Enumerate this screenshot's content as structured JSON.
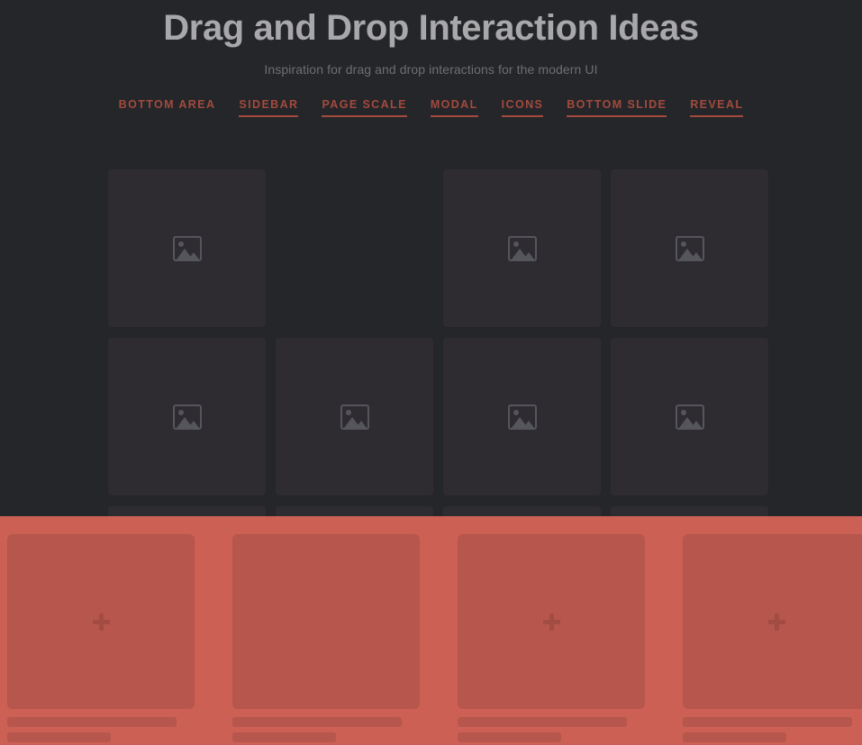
{
  "header": {
    "title": "Drag and Drop Interaction Ideas",
    "subtitle": "Inspiration for drag and drop interactions for the modern UI"
  },
  "nav": {
    "items": [
      {
        "label": "BOTTOM AREA",
        "active": true
      },
      {
        "label": "SIDEBAR",
        "active": false
      },
      {
        "label": "PAGE SCALE",
        "active": false
      },
      {
        "label": "MODAL",
        "active": false
      },
      {
        "label": "ICONS",
        "active": false
      },
      {
        "label": "BOTTOM SLIDE",
        "active": false
      },
      {
        "label": "REVEAL",
        "active": false
      }
    ]
  },
  "gallery": {
    "icon_name": "image-placeholder-icon",
    "rows": [
      {
        "tiles": [
          {
            "filled": true
          },
          {
            "filled": false
          },
          {
            "filled": true
          },
          {
            "filled": true
          }
        ]
      },
      {
        "tiles": [
          {
            "filled": true
          },
          {
            "filled": true
          },
          {
            "filled": true
          },
          {
            "filled": true
          }
        ]
      },
      {
        "tiles": [
          {
            "filled": true
          },
          {
            "filled": true
          },
          {
            "filled": true
          },
          {
            "filled": true
          }
        ]
      }
    ]
  },
  "drawer": {
    "accent_color": "#cc6055",
    "card_color": "#b6564c",
    "add_icon_name": "plus-icon",
    "cards": [
      {
        "has_plus": true
      },
      {
        "has_plus": false
      },
      {
        "has_plus": true
      },
      {
        "has_plus": true
      },
      {
        "has_plus": true
      }
    ]
  },
  "colors": {
    "background": "#252629",
    "tile": "#2e2c31",
    "title_text": "#a8a8ab",
    "subtitle_text": "#6e6e73",
    "nav_link": "#a34a3e",
    "drawer_bg": "#cc6055",
    "drawer_card": "#b6564c",
    "plus": "#a34c43"
  }
}
